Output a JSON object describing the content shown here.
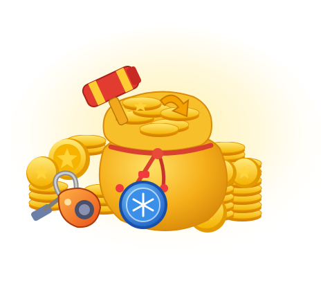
{
  "scene": {
    "background": "#ffffff",
    "glow_color": "#ffe27a",
    "coin_color": "#f7b500",
    "coin_highlight": "#ffe36a",
    "coin_star_color": "#ffd43b",
    "bag_color": "#f7b51c",
    "rope_color": "#d8412f",
    "items": [
      {
        "name": "hammer",
        "icon": "hammer-icon",
        "accent": "#e23b2f"
      },
      {
        "name": "arrow",
        "icon": "arrow-icon",
        "accent": "#f0a400"
      },
      {
        "name": "vacuum",
        "icon": "vacuum-icon",
        "accent": "#f05a1c"
      },
      {
        "name": "freeze-timer",
        "icon": "snowflake-stopwatch-icon",
        "accent": "#2f7ddc"
      }
    ]
  }
}
